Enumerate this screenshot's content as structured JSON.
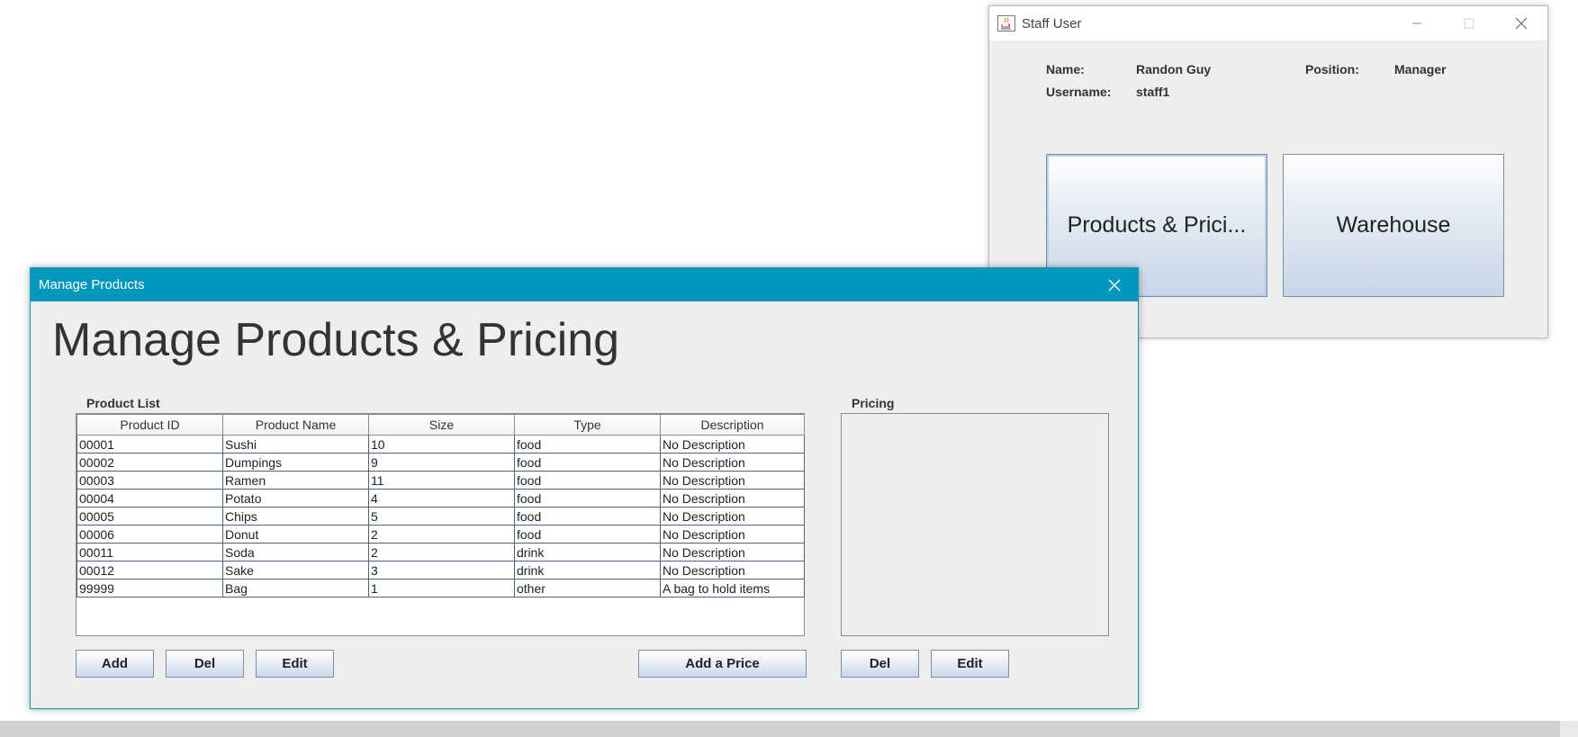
{
  "staff_window": {
    "title": "Staff User",
    "name_label": "Name:",
    "name_value": "Randon Guy",
    "position_label": "Position:",
    "position_value": "Manager",
    "username_label": "Username:",
    "username_value": "staff1",
    "products_button": "Products & Prici...",
    "warehouse_button": "Warehouse"
  },
  "manage_window": {
    "title": "Manage Products",
    "heading": "Manage Products & Pricing",
    "product_list_label": "Product List",
    "pricing_label": "Pricing",
    "columns": [
      "Product ID",
      "Product Name",
      "Size",
      "Type",
      "Description"
    ],
    "rows": [
      [
        "00001",
        "Sushi",
        "10",
        "food",
        "No Description"
      ],
      [
        "00002",
        "Dumpings",
        "9",
        "food",
        "No Description"
      ],
      [
        "00003",
        "Ramen",
        "11",
        "food",
        "No Description"
      ],
      [
        "00004",
        "Potato",
        "4",
        "food",
        "No Description"
      ],
      [
        "00005",
        "Chips",
        "5",
        "food",
        "No Description"
      ],
      [
        "00006",
        "Donut",
        "2",
        "food",
        "No Description"
      ],
      [
        "00011",
        "Soda",
        "2",
        "drink",
        "No Description"
      ],
      [
        "00012",
        "Sake",
        "3",
        "drink",
        "No Description"
      ],
      [
        "99999",
        "Bag",
        "1",
        "other",
        "A bag to hold items"
      ]
    ],
    "buttons": {
      "add": "Add",
      "del": "Del",
      "edit": "Edit",
      "add_price": "Add a Price",
      "pricing_del": "Del",
      "pricing_edit": "Edit"
    }
  },
  "colors": {
    "title_bar_accent": "#0298bd",
    "window_background": "#eeeeee"
  }
}
